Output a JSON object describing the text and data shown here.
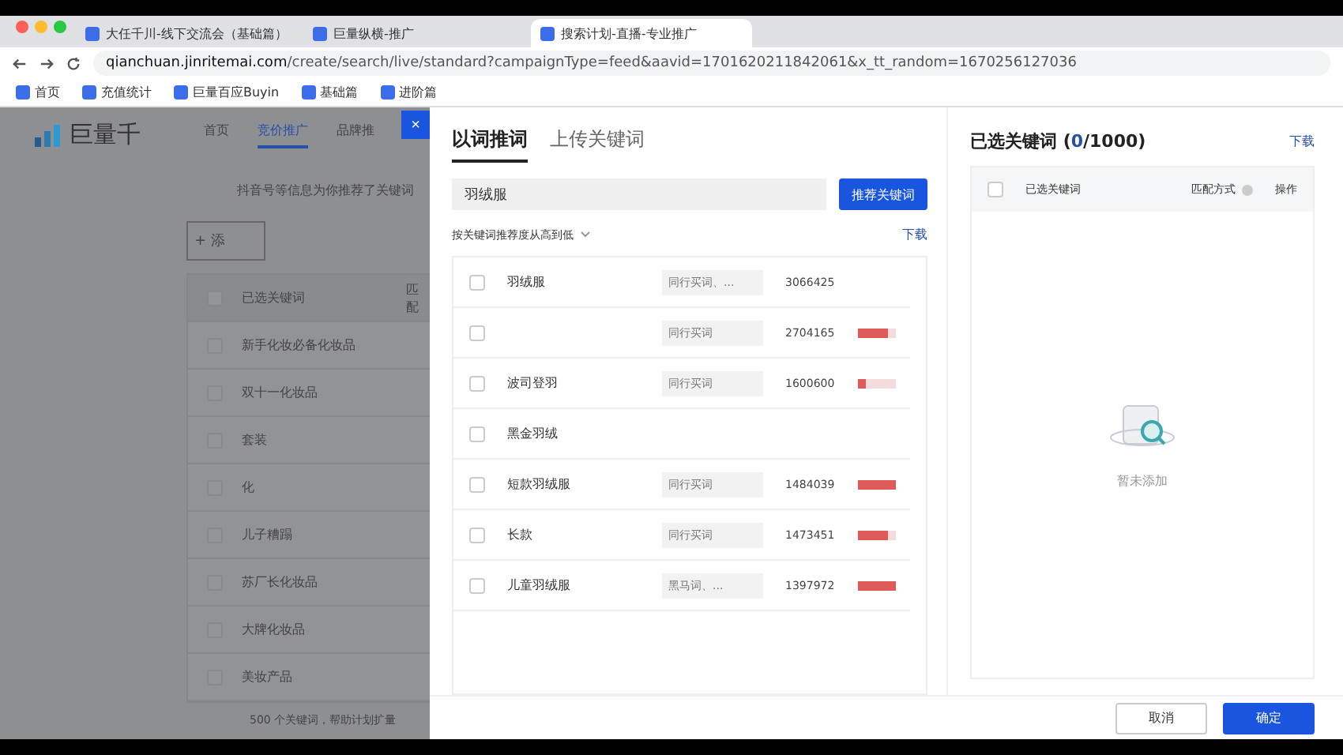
{
  "browser": {
    "tabs": [
      {
        "title": "大任千川-线下交流会（基础篇）",
        "selected": false
      },
      {
        "title": "巨量纵横-推广",
        "selected": false
      },
      {
        "title": "搜索计划-直播-专业推广",
        "selected": true
      }
    ],
    "url_host": "qianchuan.jinritemai.com",
    "url_path": "/create/search/live/standard?campaignType=feed&aavid=1701620211842061&x_tt_random=1670256127036",
    "bookmarks": [
      "首页",
      "充值统计",
      "巨量百应Buyin",
      "基础篇",
      "进阶篇"
    ]
  },
  "background": {
    "logo": "巨量千",
    "nav": [
      {
        "label": "首页",
        "selected": false
      },
      {
        "label": "竞价推广",
        "selected": true
      },
      {
        "label": "品牌推",
        "selected": false
      }
    ],
    "hint": "抖音号等信息为你推荐了关键词",
    "add_button": "+ 添",
    "columns": [
      "已选关键词",
      "匹配"
    ],
    "header_checked": false,
    "rows": [
      {
        "label": "新手化妆必备化妆品",
        "checked": false
      },
      {
        "label": "双十一化妆品",
        "checked": false
      },
      {
        "label": "套装",
        "checked": false
      },
      {
        "label": "化",
        "checked": false
      },
      {
        "label": "儿子糟蹋",
        "checked": false
      },
      {
        "label": "苏厂长化妆品",
        "checked": false
      },
      {
        "label": "大牌化妆品",
        "checked": false
      },
      {
        "label": "美妆产品",
        "checked": false
      }
    ],
    "footer": "500 个关键词，帮助计划扩量"
  },
  "drawer": {
    "close": "×",
    "tabs": [
      {
        "label": "以词推词",
        "selected": true
      },
      {
        "label": "上传关键词",
        "selected": false
      }
    ],
    "search_value": "羽绒服",
    "search_button": "推荐关键词",
    "sort": "按关键词推荐度从高到低",
    "download": "下载",
    "rows": [
      {
        "name": "羽绒服",
        "tag": "同行买词、...",
        "count": "3066425",
        "checked": false
      },
      {
        "tag": "同行买词",
        "count": "2704165",
        "level": 0.8,
        "checked": false
      },
      {
        "name": "波司登羽",
        "tag": "同行买词",
        "count": "1600600",
        "level": 0.2,
        "checked": false
      },
      {
        "name": "黑金羽绒",
        "checked": false
      },
      {
        "name": "短款羽绒服",
        "tag": "同行买词",
        "count": "1484039",
        "level": 1,
        "checked": false
      },
      {
        "name": "长款",
        "tag": "同行买词",
        "count": "1473451",
        "level": 0.8,
        "checked": false
      },
      {
        "name": "儿童羽绒服",
        "tag": "黑马词、...",
        "count": "1397972",
        "level": 1,
        "checked": false
      }
    ]
  },
  "selected_panel": {
    "title": "已选关键词 (",
    "count": "0",
    "total": "/1000)",
    "download": "下载",
    "columns": [
      "已选关键词",
      "匹配方式",
      "操作"
    ],
    "header_checked": false,
    "empty": "暂未添加"
  },
  "footer": {
    "cancel": "取消",
    "confirm": "确定"
  }
}
